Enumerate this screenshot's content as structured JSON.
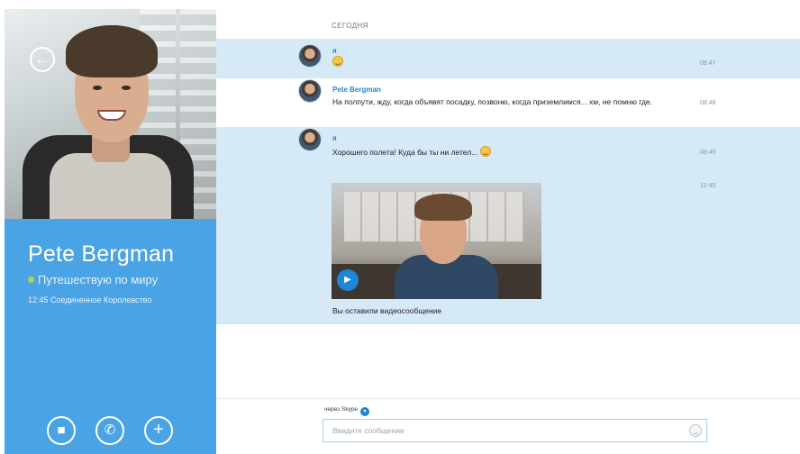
{
  "contact": {
    "name": "Pete Bergman",
    "status": "Путешествую по миру",
    "local_info": "12:45 Соединенное Королевство",
    "status_color": "#b3d44a"
  },
  "sidebar": {
    "background_color": "#4aa3e4",
    "back_icon": "back-arrow-icon",
    "call_buttons": [
      {
        "name": "video-call-button",
        "icon": "video-camera-icon",
        "glyph": "■"
      },
      {
        "name": "voice-call-button",
        "icon": "phone-icon",
        "glyph": "✆"
      },
      {
        "name": "add-button",
        "icon": "plus-icon",
        "glyph": "+"
      }
    ]
  },
  "conversation": {
    "date_label": "СЕГОДНЯ",
    "messages": [
      {
        "sender": "я",
        "text": "",
        "emoji": "smile-emoji",
        "time": "08:47"
      },
      {
        "sender": "Pete Bergman",
        "text": "На полпути, жду, когда объявят посадку, позвоню, когда приземлимся... хм, не помню где.",
        "time": "08:48"
      },
      {
        "sender": "я",
        "text": "Хорошего полета! Куда бы ты ни летел...",
        "emoji": "grin-emoji",
        "time": "08:49"
      }
    ],
    "video_message": {
      "time": "12:45",
      "caption": "Вы оставили видеосообщение",
      "play_icon": "play-icon"
    }
  },
  "composer": {
    "via_label": "через Skype",
    "placeholder": "Введите сообщение",
    "value": "",
    "accent_color": "#1e86d8"
  }
}
